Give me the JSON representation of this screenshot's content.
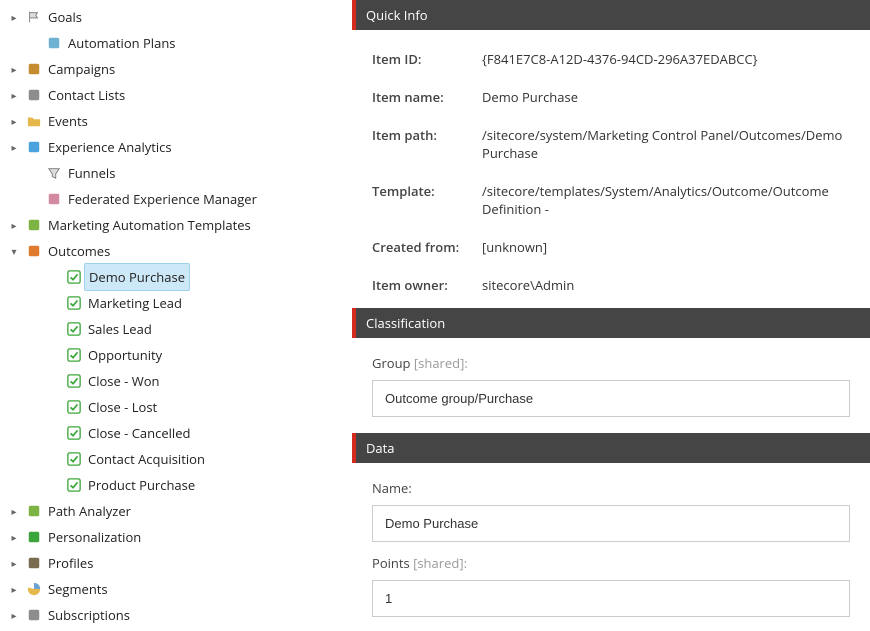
{
  "tree": {
    "items": [
      {
        "label": "Goals",
        "icon": "flag",
        "expand": "closed",
        "indent": 0
      },
      {
        "label": "Automation Plans",
        "icon": "plan",
        "expand": "none",
        "indent": 1
      },
      {
        "label": "Campaigns",
        "icon": "campaign",
        "expand": "closed",
        "indent": 0
      },
      {
        "label": "Contact Lists",
        "icon": "list",
        "expand": "closed",
        "indent": 0
      },
      {
        "label": "Events",
        "icon": "folder",
        "expand": "closed",
        "indent": 0
      },
      {
        "label": "Experience Analytics",
        "icon": "analytics",
        "expand": "closed",
        "indent": 0
      },
      {
        "label": "Funnels",
        "icon": "funnel",
        "expand": "none",
        "indent": 1
      },
      {
        "label": "Federated Experience Manager",
        "icon": "fxm",
        "expand": "none",
        "indent": 1
      },
      {
        "label": "Marketing Automation Templates",
        "icon": "mat",
        "expand": "closed",
        "indent": 0
      },
      {
        "label": "Outcomes",
        "icon": "outcome",
        "expand": "open",
        "indent": 0
      },
      {
        "label": "Demo Purchase",
        "icon": "check",
        "expand": "none",
        "indent": 2,
        "selected": true
      },
      {
        "label": "Marketing Lead",
        "icon": "check",
        "expand": "none",
        "indent": 2
      },
      {
        "label": "Sales Lead",
        "icon": "check",
        "expand": "none",
        "indent": 2
      },
      {
        "label": "Opportunity",
        "icon": "check",
        "expand": "none",
        "indent": 2
      },
      {
        "label": "Close - Won",
        "icon": "check",
        "expand": "none",
        "indent": 2
      },
      {
        "label": "Close - Lost",
        "icon": "check",
        "expand": "none",
        "indent": 2
      },
      {
        "label": "Close - Cancelled",
        "icon": "check",
        "expand": "none",
        "indent": 2
      },
      {
        "label": "Contact Acquisition",
        "icon": "check",
        "expand": "none",
        "indent": 2
      },
      {
        "label": "Product Purchase",
        "icon": "check",
        "expand": "none",
        "indent": 2
      },
      {
        "label": "Path Analyzer",
        "icon": "path",
        "expand": "closed",
        "indent": 0
      },
      {
        "label": "Personalization",
        "icon": "personalization",
        "expand": "closed",
        "indent": 0
      },
      {
        "label": "Profiles",
        "icon": "profiles",
        "expand": "closed",
        "indent": 0
      },
      {
        "label": "Segments",
        "icon": "segments",
        "expand": "closed",
        "indent": 0
      },
      {
        "label": "Subscriptions",
        "icon": "subscriptions",
        "expand": "closed",
        "indent": 0
      }
    ]
  },
  "sections": {
    "quickinfo": {
      "title": "Quick Info",
      "item_id_label": "Item ID:",
      "item_id": "{F841E7C8-A12D-4376-94CD-296A37EDABCC}",
      "item_name_label": "Item name:",
      "item_name": "Demo Purchase",
      "item_path_label": "Item path:",
      "item_path": "/sitecore/system/Marketing Control Panel/Outcomes/Demo Purchase",
      "template_label": "Template:",
      "template": "/sitecore/templates/System/Analytics/Outcome/Outcome Definition - ",
      "created_from_label": "Created from:",
      "created_from": "[unknown]",
      "item_owner_label": "Item owner:",
      "item_owner": "sitecore\\Admin"
    },
    "classification": {
      "title": "Classification",
      "group_label": "Group",
      "shared": " [shared]:",
      "group_value": "Outcome group/Purchase"
    },
    "data": {
      "title": "Data",
      "name_label": "Name:",
      "name_value": "Demo Purchase",
      "points_label": "Points",
      "shared": " [shared]:",
      "points_value": "1"
    }
  },
  "icons": {
    "flag": "#8d8d8d",
    "plan": "#6fb1d1",
    "campaign": "#c58b2f",
    "list": "#8d8d8d",
    "folder": "#e6b84c",
    "analytics": "#4aa3df",
    "funnel": "#8d8d8d",
    "fxm": "#d38aa0",
    "mat": "#7cb342",
    "outcome": "#e07a2f",
    "check": "#3aa53a",
    "path": "#7cb342",
    "personalization": "#3aa53a",
    "profiles": "#7a6a4f",
    "segments": "#e6b84c",
    "subscriptions": "#8d8d8d"
  }
}
